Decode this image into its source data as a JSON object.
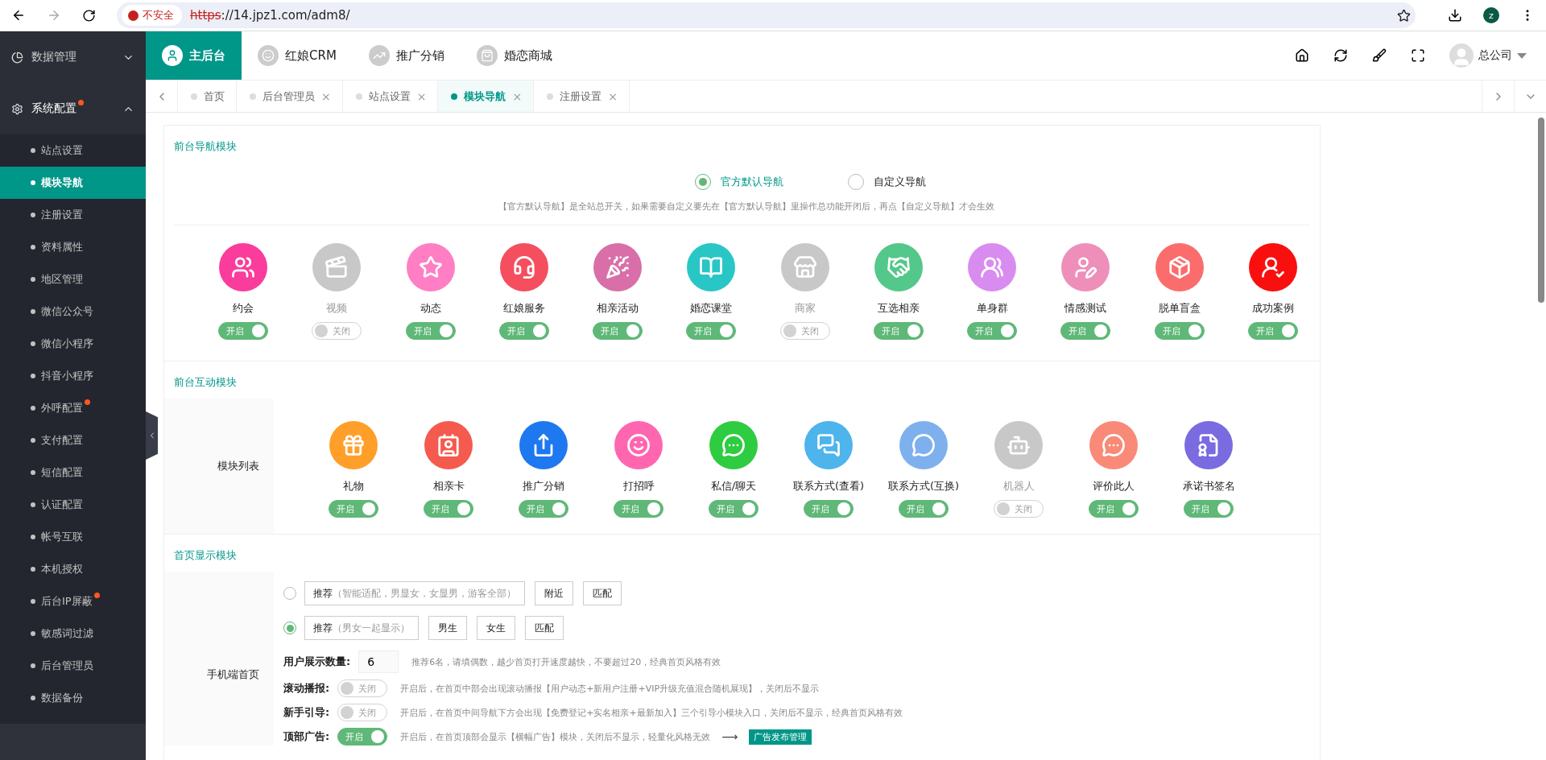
{
  "browser": {
    "security": "不安全",
    "url_scheme": "https",
    "url_rest": "://14.jpz1.com/adm8/",
    "profile": "z"
  },
  "sidebar": {
    "groups": [
      {
        "label": "数据管理",
        "expanded": false,
        "dot": false
      },
      {
        "label": "系统配置",
        "expanded": true,
        "dot": true
      }
    ],
    "items": [
      {
        "label": "站点设置",
        "selected": false,
        "dot": false
      },
      {
        "label": "模块导航",
        "selected": true,
        "dot": false
      },
      {
        "label": "注册设置",
        "selected": false,
        "dot": false
      },
      {
        "label": "资料属性",
        "selected": false,
        "dot": false
      },
      {
        "label": "地区管理",
        "selected": false,
        "dot": false
      },
      {
        "label": "微信公众号",
        "selected": false,
        "dot": false
      },
      {
        "label": "微信小程序",
        "selected": false,
        "dot": false
      },
      {
        "label": "抖音小程序",
        "selected": false,
        "dot": false
      },
      {
        "label": "外呼配置",
        "selected": false,
        "dot": true
      },
      {
        "label": "支付配置",
        "selected": false,
        "dot": false
      },
      {
        "label": "短信配置",
        "selected": false,
        "dot": false
      },
      {
        "label": "认证配置",
        "selected": false,
        "dot": false
      },
      {
        "label": "帐号互联",
        "selected": false,
        "dot": false
      },
      {
        "label": "本机授权",
        "selected": false,
        "dot": false
      },
      {
        "label": "后台IP屏蔽",
        "selected": false,
        "dot": true
      },
      {
        "label": "敏感词过滤",
        "selected": false,
        "dot": false
      },
      {
        "label": "后台管理员",
        "selected": false,
        "dot": false
      },
      {
        "label": "数据备份",
        "selected": false,
        "dot": false
      }
    ]
  },
  "top_nav": [
    {
      "label": "主后台",
      "selected": true
    },
    {
      "label": "红娘CRM",
      "selected": false
    },
    {
      "label": "推广分销",
      "selected": false
    },
    {
      "label": "婚恋商城",
      "selected": false
    }
  ],
  "user": "总公司",
  "page_tabs": [
    {
      "label": "首页",
      "selected": false,
      "closable": false
    },
    {
      "label": "后台管理员",
      "selected": false,
      "closable": true
    },
    {
      "label": "站点设置",
      "selected": false,
      "closable": true
    },
    {
      "label": "模块导航",
      "selected": true,
      "closable": true
    },
    {
      "label": "注册设置",
      "selected": false,
      "closable": true
    }
  ],
  "close_glyph": "×",
  "nav_section": {
    "title": "前台导航模块",
    "options": [
      {
        "label": "官方默认导航",
        "selected": true
      },
      {
        "label": "自定义导航",
        "selected": false
      }
    ],
    "hint": "【官方默认导航】是全站总开关，如果需要自定义要先在【官方默认导航】里操作总功能开闭后，再点【自定义导航】才会生效",
    "modules": [
      {
        "label": "约会",
        "on": true,
        "toggle_text": "开启",
        "color": "#fa3c9c"
      },
      {
        "label": "视频",
        "on": false,
        "toggle_text": "关闭",
        "color": "#c8c8c8"
      },
      {
        "label": "动态",
        "on": true,
        "toggle_text": "开启",
        "color": "#ff7ec4"
      },
      {
        "label": "红娘服务",
        "on": true,
        "toggle_text": "开启",
        "color": "#f54e5e"
      },
      {
        "label": "相亲活动",
        "on": true,
        "toggle_text": "开启",
        "color": "#d96fa8"
      },
      {
        "label": "婚恋课堂",
        "on": true,
        "toggle_text": "开启",
        "color": "#29c6c6"
      },
      {
        "label": "商家",
        "on": false,
        "toggle_text": "关闭",
        "color": "#c8c8c8"
      },
      {
        "label": "互选相亲",
        "on": true,
        "toggle_text": "开启",
        "color": "#53c88a"
      },
      {
        "label": "单身群",
        "on": true,
        "toggle_text": "开启",
        "color": "#d98cf0"
      },
      {
        "label": "情感测试",
        "on": true,
        "toggle_text": "开启",
        "color": "#ee8fba"
      },
      {
        "label": "脱单盲盒",
        "on": true,
        "toggle_text": "开启",
        "color": "#fb6d6d"
      },
      {
        "label": "成功案例",
        "on": true,
        "toggle_text": "开启",
        "color": "#fa0f0f"
      }
    ]
  },
  "interact_section": {
    "title": "前台互动模块",
    "row_label": "模块列表",
    "modules": [
      {
        "label": "礼物",
        "on": true,
        "toggle_text": "开启",
        "color": "#ff9f2a"
      },
      {
        "label": "相亲卡",
        "on": true,
        "toggle_text": "开启",
        "color": "#f55a4e"
      },
      {
        "label": "推广分销",
        "on": true,
        "toggle_text": "开启",
        "color": "#1e78f0"
      },
      {
        "label": "打招呼",
        "on": true,
        "toggle_text": "开启",
        "color": "#ff66b0"
      },
      {
        "label": "私信/聊天",
        "on": true,
        "toggle_text": "开启",
        "color": "#2ecc40"
      },
      {
        "label": "联系方式(查看)",
        "on": true,
        "toggle_text": "开启",
        "color": "#4db4ec"
      },
      {
        "label": "联系方式(互换)",
        "on": true,
        "toggle_text": "开启",
        "color": "#7fb0ee"
      },
      {
        "label": "机器人",
        "on": false,
        "toggle_text": "关闭",
        "color": "#c8c8c8"
      },
      {
        "label": "评价此人",
        "on": true,
        "toggle_text": "开启",
        "color": "#f98a78"
      },
      {
        "label": "承诺书签名",
        "on": true,
        "toggle_text": "开启",
        "color": "#7a6be0"
      }
    ]
  },
  "home_section": {
    "title": "首页显示模块",
    "row_label": "手机端首页",
    "modes": [
      {
        "selected": false,
        "field": {
          "value": "推荐",
          "hint": "（智能适配，男显女，女显男，游客全部）"
        },
        "buttons": [
          "附近",
          "匹配"
        ]
      },
      {
        "selected": true,
        "field": {
          "value": "推荐",
          "hint": "（男女一起显示）"
        },
        "buttons": [
          "男生",
          "女生",
          "匹配"
        ]
      }
    ],
    "count": {
      "label": "用户展示数量:",
      "value": "6",
      "hint": "推荐6名，请填偶数，越少首页打开速度越快，不要超过20，经典首页风格有效"
    },
    "switches": [
      {
        "label": "滚动播报:",
        "on": false,
        "toggle_text": "关闭",
        "hint": "开启后，在首页中部会出现滚动播报【用户动态+新用户注册+VIP升级充值混合随机展现】，关闭后不显示"
      },
      {
        "label": "新手引导:",
        "on": false,
        "toggle_text": "关闭",
        "hint": "开启后，在首页中间导航下方会出现【免费登记+实名相亲+最新加入】三个引导小模块入口，关闭后不显示，经典首页风格有效"
      },
      {
        "label": "顶部广告:",
        "on": true,
        "toggle_text": "开启",
        "hint": "开启后，在首页顶部会显示【横幅广告】模块，关闭后不显示，轻量化风格无效",
        "arrow": "⟶",
        "link": "广告发布管理"
      }
    ]
  }
}
